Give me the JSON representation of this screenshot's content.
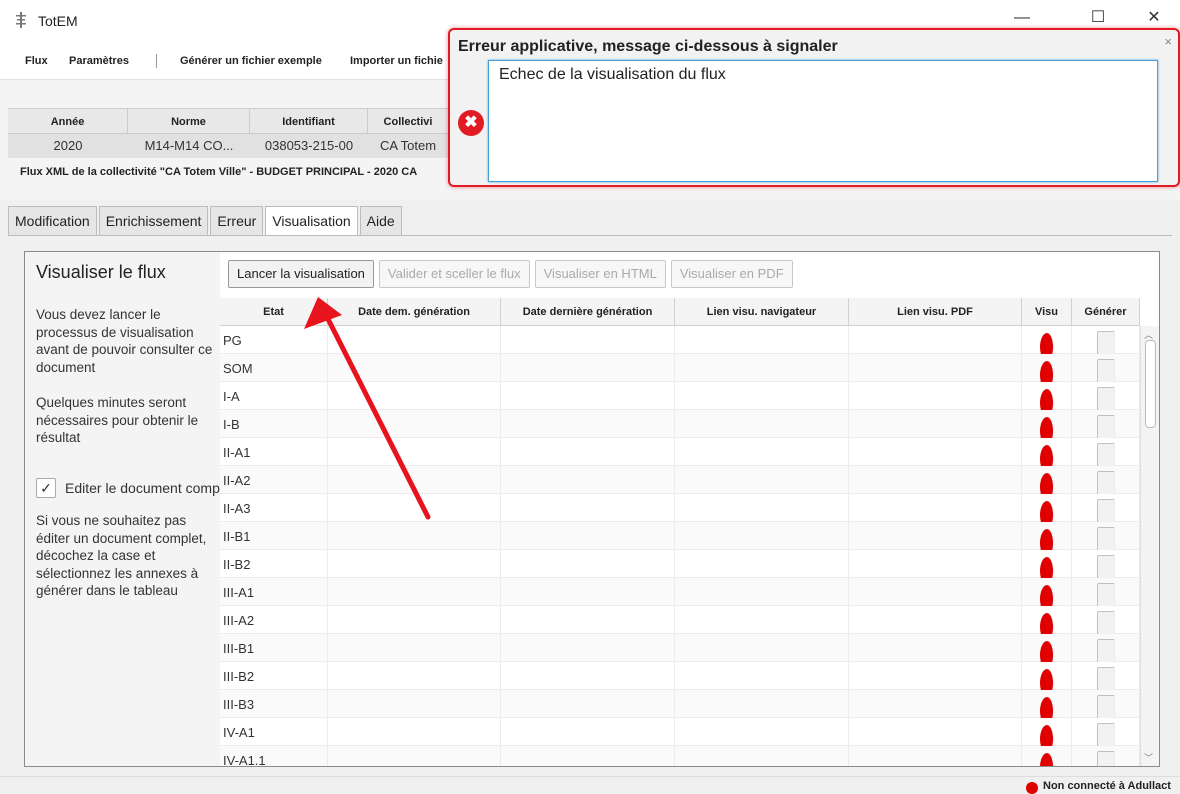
{
  "window": {
    "title": "TotEM",
    "minimize": "—",
    "maximize": "☐",
    "close": "✕"
  },
  "menu": {
    "flux": "Flux",
    "parametres": "Paramètres",
    "generer": "Générer un fichier exemple",
    "importer": "Importer un fichie"
  },
  "info_grid": {
    "headers": [
      "Année",
      "Norme",
      "Identifiant",
      "Collectivi"
    ],
    "row": [
      "2020",
      "M14-M14 CO...",
      "038053-215-00",
      "CA Totem"
    ]
  },
  "flux_label": "Flux XML de la collectivité \"CA Totem Ville\" - BUDGET PRINCIPAL - 2020 CA",
  "tabs": [
    "Modification",
    "Enrichissement",
    "Erreur",
    "Visualisation",
    "Aide"
  ],
  "active_tab": "Visualisation",
  "panel": {
    "title": "Visualiser le flux",
    "text1": "Vous devez lancer le processus de visualisation avant de pouvoir consulter ce document",
    "text2": "Quelques minutes seront nécessaires pour obtenir le résultat",
    "checkbox_label": "Editer le document complet",
    "checkbox_checked": true,
    "checkbox_mark": "✓",
    "text3": "Si vous ne souhaitez pas éditer un document complet, décochez la case et sélectionnez les annexes à générer dans le tableau"
  },
  "toolbar": {
    "lancer": "Lancer la visualisation",
    "valider": "Valider et sceller le flux",
    "html": "Visualiser en HTML",
    "pdf": "Visualiser en PDF"
  },
  "table": {
    "headers": [
      "Etat",
      "Date dem. génération",
      "Date dernière génération",
      "Lien visu. navigateur",
      "Lien visu. PDF",
      "Visu",
      "Générer"
    ],
    "rows": [
      "PG",
      "SOM",
      "I-A",
      "I-B",
      "II-A1",
      "II-A2",
      "II-A3",
      "II-B1",
      "II-B2",
      "III-A1",
      "III-A2",
      "III-B1",
      "III-B2",
      "III-B3",
      "IV-A1",
      "IV-A1.1"
    ],
    "visu_color": "#e00000"
  },
  "status": {
    "text": "Non connecté à Adullact",
    "color": "#e00000"
  },
  "dialog": {
    "title": "Erreur applicative, message ci-dessous à signaler",
    "message": "Echec de la visualisation du flux",
    "close": "×",
    "icon": "✖",
    "border_color": "#e01b24"
  }
}
